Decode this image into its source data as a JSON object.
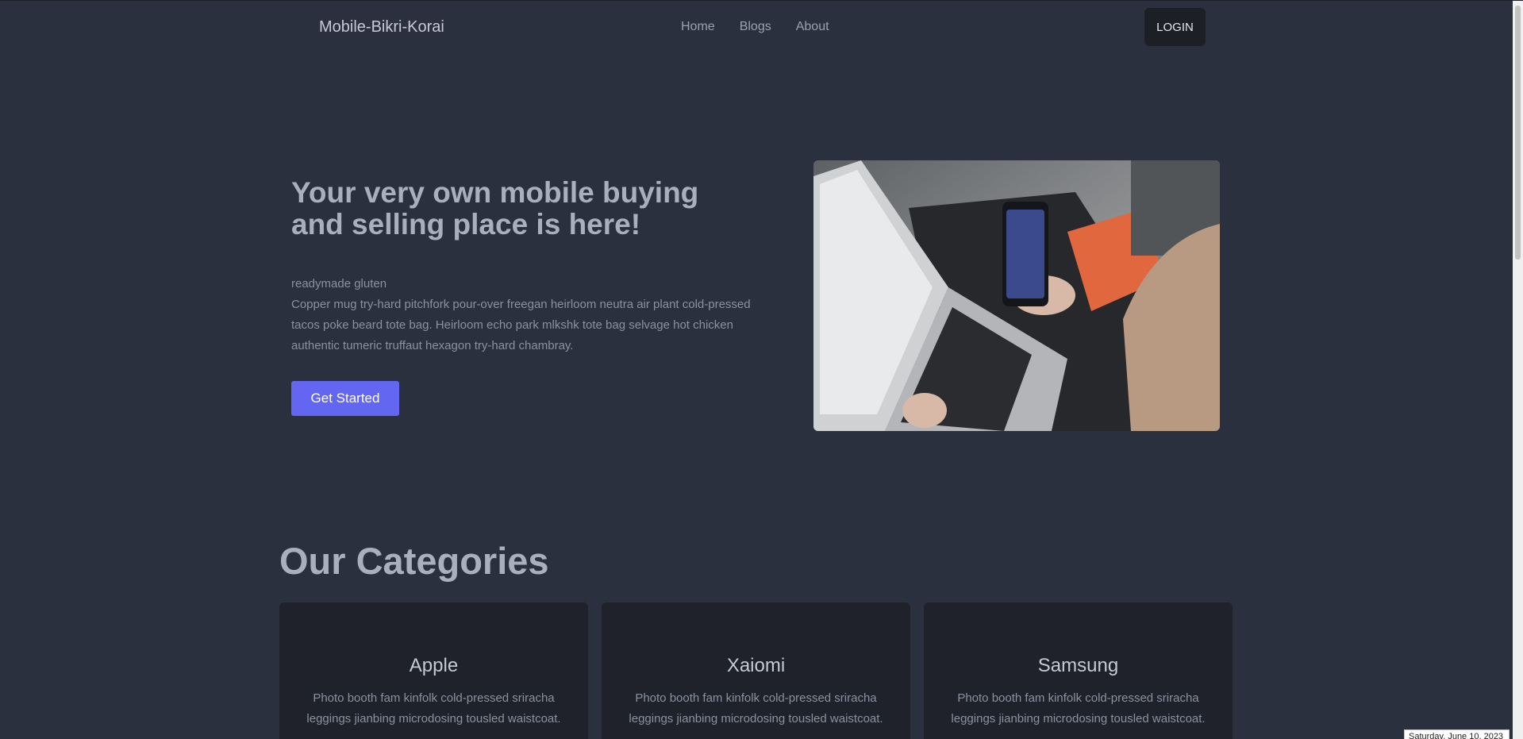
{
  "header": {
    "brand": "Mobile-Bikri-Korai",
    "nav": [
      "Home",
      "Blogs",
      "About"
    ],
    "login_label": "LOGIN"
  },
  "hero": {
    "title": "Your very own mobile buying and selling place is here!",
    "subtitle": "readymade gluten",
    "paragraph": "Copper mug try-hard pitchfork pour-over freegan heirloom neutra air plant cold-pressed tacos poke beard tote bag. Heirloom echo park mlkshk tote bag selvage hot chicken authentic tumeric truffaut hexagon try-hard chambray.",
    "cta_label": "Get Started"
  },
  "categories": {
    "heading": "Our Categories",
    "items": [
      {
        "title": "Apple",
        "text": "Photo booth fam kinfolk cold-pressed sriracha leggings jianbing microdosing tousled waistcoat."
      },
      {
        "title": "Xaiomi",
        "text": "Photo booth fam kinfolk cold-pressed sriracha leggings jianbing microdosing tousled waistcoat."
      },
      {
        "title": "Samsung",
        "text": "Photo booth fam kinfolk cold-pressed sriracha leggings jianbing microdosing tousled waistcoat."
      }
    ]
  },
  "taskbar": {
    "date": "Saturday, June 10, 2023"
  },
  "colors": {
    "background": "#2a303d",
    "card": "#1f222b",
    "accent": "#6366f1"
  }
}
